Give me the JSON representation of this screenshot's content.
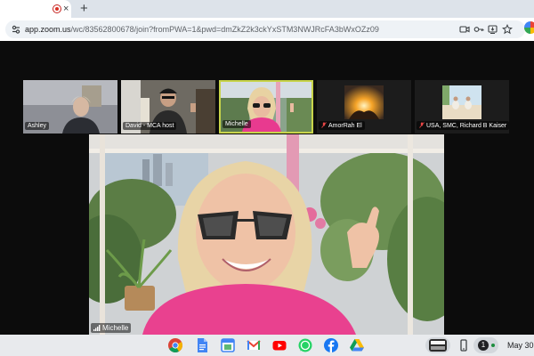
{
  "browser": {
    "tab_close_glyph": "×",
    "new_tab_glyph": "+",
    "url_host": "app.zoom.us",
    "url_path": "/wc/83562800678/join?fromPWA=1&pwd=dmZkZ2k3ckYxSTM3NWJRcFA3bWxOZz09",
    "omnibox_icons": [
      "camera-icon",
      "password-key-icon",
      "install-app-icon",
      "share-icon",
      "bookmark-star-icon"
    ]
  },
  "meeting": {
    "participants": [
      {
        "name": "Ashley",
        "muted": false,
        "active": false
      },
      {
        "name": "David - MCA host",
        "muted": false,
        "active": false
      },
      {
        "name": "Michelle",
        "muted": false,
        "active": true
      },
      {
        "name": "AmorRah El",
        "muted": true,
        "active": false
      },
      {
        "name": "USA, SMC, Richard B Kaiser",
        "muted": true,
        "active": false
      }
    ],
    "speaker_name": "Michelle"
  },
  "shelf": {
    "apps": [
      "chrome-icon",
      "docs-icon",
      "calendar-icon",
      "gmail-icon",
      "youtube-icon",
      "whatsapp-icon",
      "facebook-icon",
      "drive-icon"
    ],
    "notification_count": "1",
    "date": "May 30"
  },
  "colors": {
    "active_speaker_border": "#c8d44a",
    "record_red": "#d93025",
    "shelf_bg": "#e8eaed"
  }
}
